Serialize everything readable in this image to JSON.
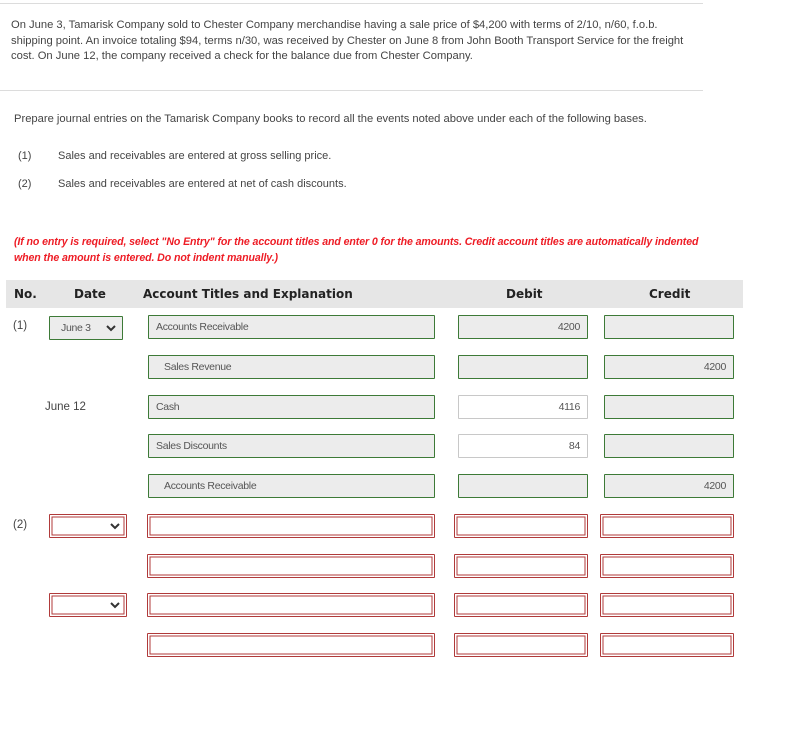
{
  "problem": {
    "text": "On June 3, Tamarisk Company sold to Chester Company merchandise having a sale price of $4,200 with terms of 2/10, n/60, f.o.b. shipping point. An invoice totaling $94, terms n/30, was received by Chester on June 8 from John Booth Transport Service for the freight cost. On June 12, the company received a check for the balance due from Chester Company."
  },
  "instructions": "Prepare journal entries on the Tamarisk Company books to record all the events noted above under each of the following bases.",
  "bases": [
    {
      "num": "(1)",
      "text": "Sales and receivables are entered at gross selling price."
    },
    {
      "num": "(2)",
      "text": "Sales and receivables are entered at net of cash discounts."
    }
  ],
  "note": "(If no entry is required, select \"No Entry\" for the account titles and enter 0 for the amounts. Credit account titles are automatically indented when the amount is entered. Do not indent manually.)",
  "table": {
    "headers": {
      "no": "No.",
      "date": "Date",
      "account": "Account Titles and Explanation",
      "debit": "Debit",
      "credit": "Credit"
    },
    "part1": {
      "num": "(1)",
      "date_select": "June 3",
      "date_2": "June 12",
      "rows": [
        {
          "account": "Accounts Receivable",
          "debit": "4200",
          "credit": ""
        },
        {
          "account": "Sales Revenue",
          "debit": "",
          "credit": "4200"
        },
        {
          "account": "Cash",
          "debit": "4116",
          "credit": ""
        },
        {
          "account": "Sales Discounts",
          "debit": "84",
          "credit": ""
        },
        {
          "account": "Accounts Receivable",
          "debit": "",
          "credit": "4200"
        }
      ]
    },
    "part2": {
      "num": "(2)",
      "date_select_1": "",
      "date_select_2": "",
      "rows": [
        {
          "account": "",
          "debit": "",
          "credit": ""
        },
        {
          "account": "",
          "debit": "",
          "credit": ""
        },
        {
          "account": "",
          "debit": "",
          "credit": ""
        },
        {
          "account": "",
          "debit": "",
          "credit": ""
        }
      ]
    }
  },
  "colors": {
    "note_red": "#ee1c25",
    "correct_border": "#3d7a37",
    "error_border": "#b03a3a",
    "header_bg": "#e6e6e6"
  },
  "icons": {
    "dropdown": "chevron-down-icon"
  }
}
